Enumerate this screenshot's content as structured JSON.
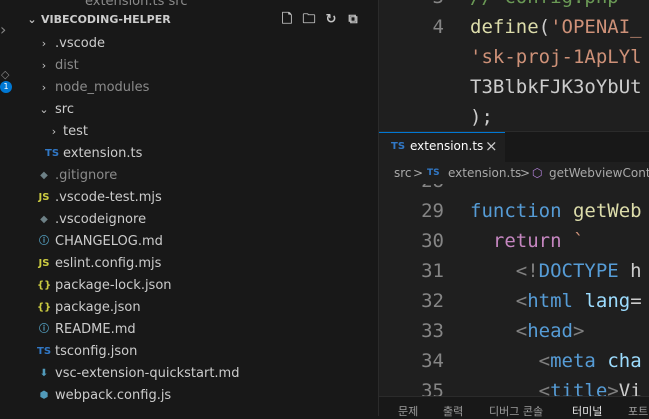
{
  "sidebar": {
    "top_partial": "extension.ts  src",
    "title": "VIBECODING-HELPER",
    "header_icons": [
      "new-file-icon",
      "new-folder-icon",
      "refresh-icon",
      "collapse-icon"
    ],
    "badge": "1",
    "items": [
      {
        "label": ".vscode",
        "kind": "folder"
      },
      {
        "label": "dist",
        "kind": "folder"
      },
      {
        "label": "node_modules",
        "kind": "folder"
      },
      {
        "label": "src",
        "kind": "folder-open"
      },
      {
        "label": "test",
        "kind": "folder"
      },
      {
        "label": "extension.ts",
        "icon": "TS"
      },
      {
        "label": ".gitignore",
        "icon": "◆"
      },
      {
        "label": ".vscode-test.mjs",
        "icon": "JS"
      },
      {
        "label": ".vscodeignore",
        "icon": "◆"
      },
      {
        "label": "CHANGELOG.md",
        "icon": "ⓘ"
      },
      {
        "label": "eslint.config.mjs",
        "icon": "JS"
      },
      {
        "label": "package-lock.json",
        "icon": "{}"
      },
      {
        "label": "package.json",
        "icon": "{}"
      },
      {
        "label": "README.md",
        "icon": "ⓘ"
      },
      {
        "label": "tsconfig.json",
        "icon": "TS"
      },
      {
        "label": "vsc-extension-quickstart.md",
        "icon": "⬇"
      },
      {
        "label": "webpack.config.js",
        "icon": "⬢"
      }
    ]
  },
  "editor_top": {
    "lines": [
      {
        "n": "3",
        "text": "// config.php"
      },
      {
        "n": "4",
        "text": "define('OPENAI_"
      },
      {
        "n": "",
        "text": "'sk-proj-1ApLYl"
      },
      {
        "n": "",
        "text": "T3BlbkFJK3oYbUt"
      },
      {
        "n": "",
        "text": ");"
      }
    ]
  },
  "tab": {
    "icon": "TS",
    "label": "extension.ts",
    "close": "×"
  },
  "breadcrumb": {
    "folder": "src",
    "sep": ">",
    "file_icon": "TS",
    "file": "extension.ts",
    "symbol": "getWebviewCont"
  },
  "editor_bottom": {
    "lines": [
      {
        "n": "28",
        "text": ""
      },
      {
        "n": "29",
        "text": "function getWeb"
      },
      {
        "n": "30",
        "text": "  return `"
      },
      {
        "n": "31",
        "text": "    <!DOCTYPE h"
      },
      {
        "n": "32",
        "text": "    <html lang="
      },
      {
        "n": "33",
        "text": "    <head>"
      },
      {
        "n": "34",
        "text": "      <meta cha"
      },
      {
        "n": "35",
        "text": "      <title>Vi"
      }
    ]
  },
  "panel_tabs": [
    "문제",
    "출력",
    "디버그 콘솔",
    "터미널",
    "포트"
  ],
  "colors": {
    "accent": "#0078d4",
    "background": "#181818",
    "editor": "#1f1f1f"
  }
}
